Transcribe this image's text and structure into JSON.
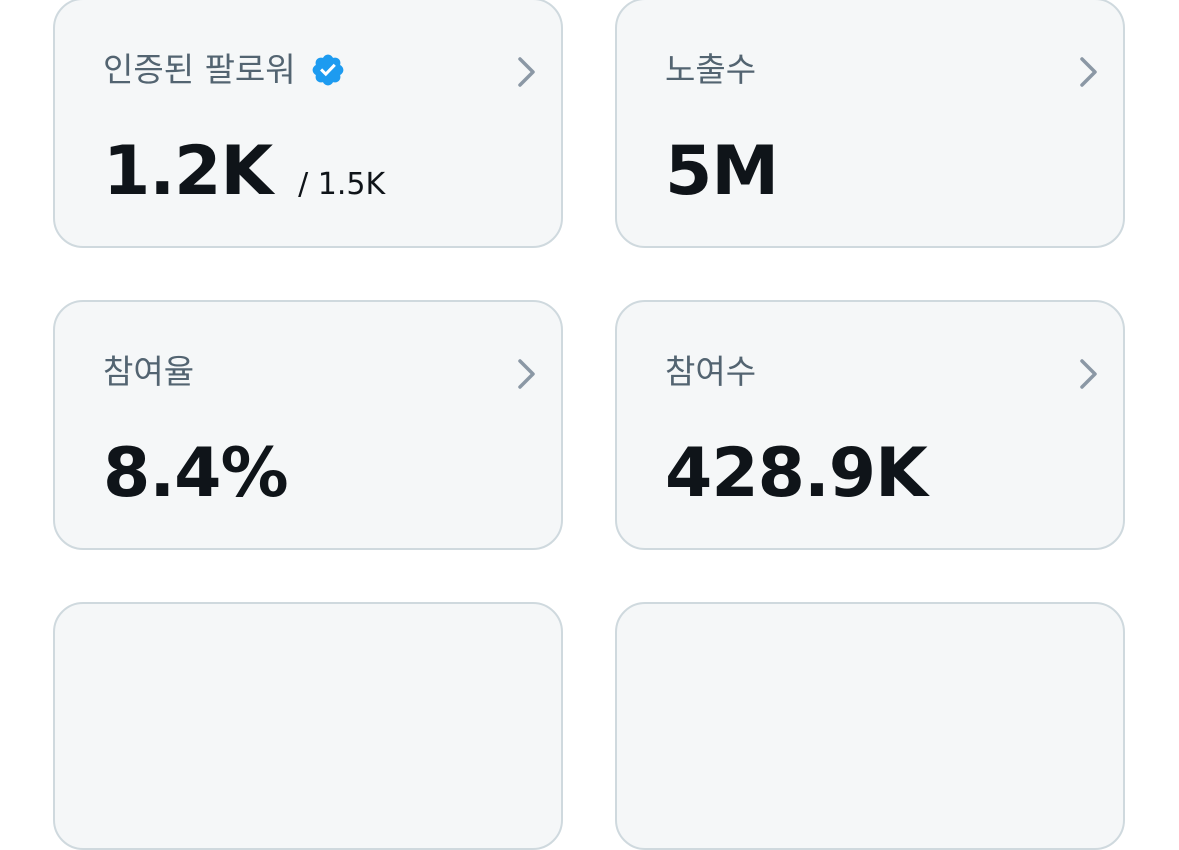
{
  "cards": [
    {
      "label": "인증된 팔로워",
      "value": "1.2K",
      "subvalue": "/ 1.5K",
      "badge_icon": "verified-badge-icon",
      "badge_color": "#1d9bf0",
      "nav_icon": "chevron-right-icon"
    },
    {
      "label": "노출수",
      "value": "5M",
      "nav_icon": "chevron-right-icon"
    },
    {
      "label": "참여율",
      "value": "8.4%",
      "nav_icon": "chevron-right-icon"
    },
    {
      "label": "참여수",
      "value": "428.9K",
      "nav_icon": "chevron-right-icon"
    }
  ],
  "colors": {
    "card_background": "#f5f7f8",
    "card_border": "#cfd9de",
    "label_text": "#536471",
    "value_text": "#0f1419",
    "chevron": "#8b98a5",
    "verified_blue": "#1d9bf0"
  }
}
